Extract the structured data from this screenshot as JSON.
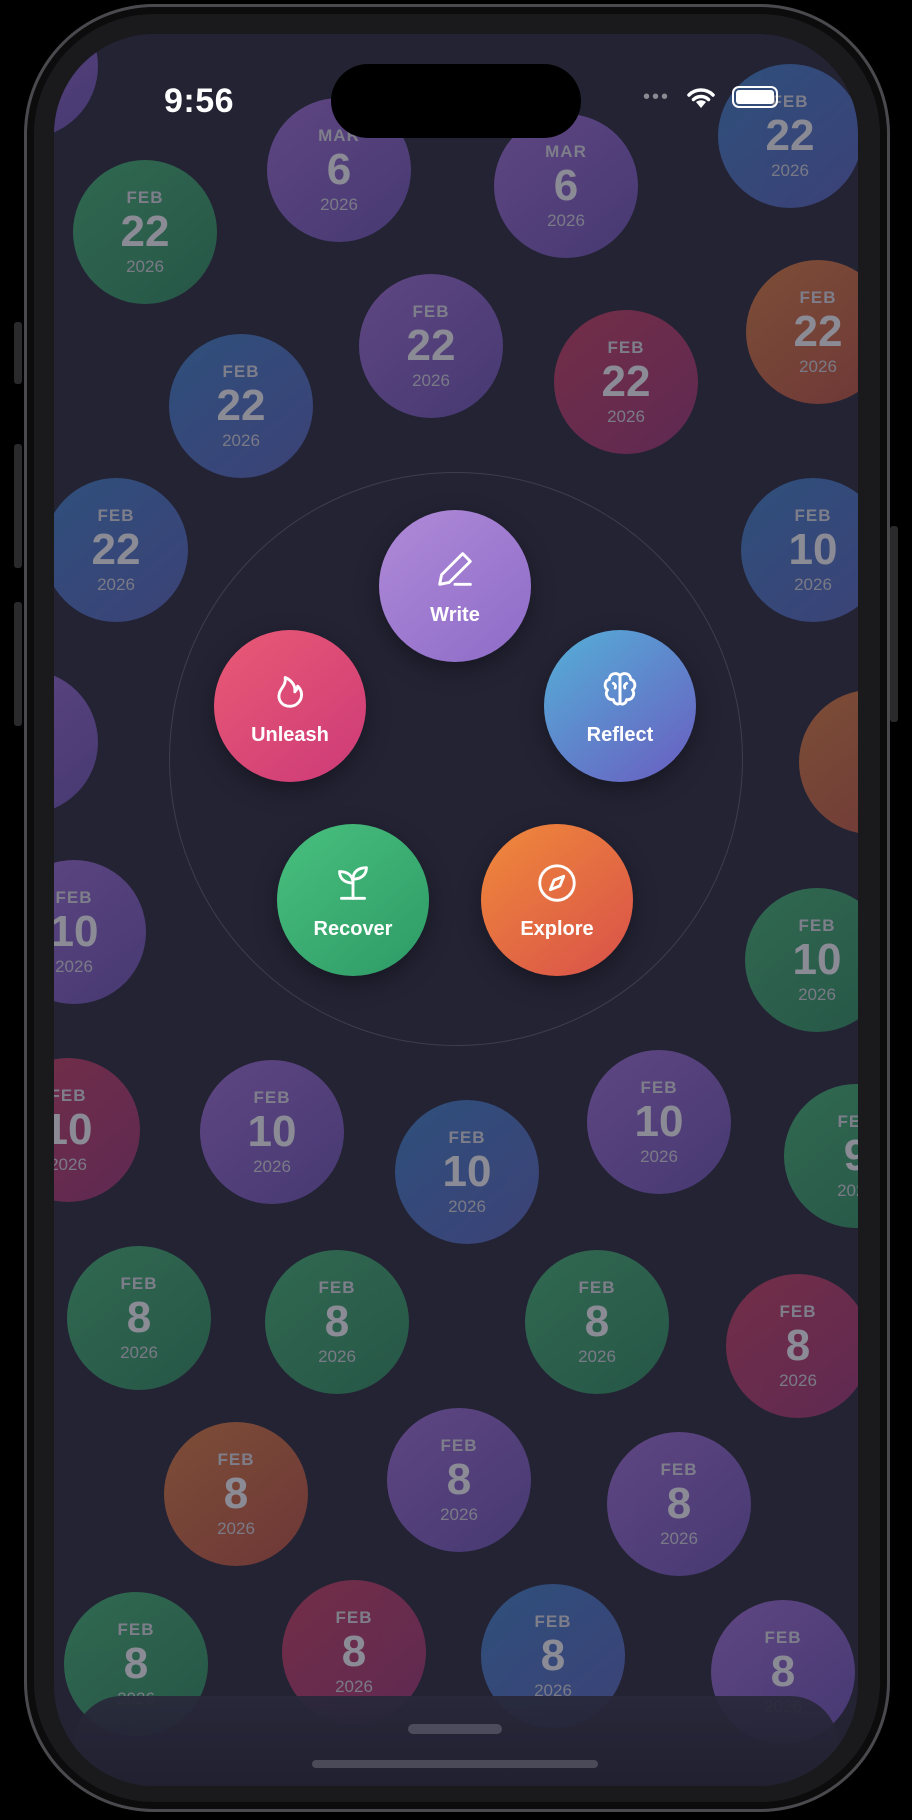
{
  "status_bar": {
    "time": "9:56"
  },
  "bubbles": [
    {
      "m": "MAR",
      "d": "6",
      "y": "2026"
    },
    {
      "m": "MAR",
      "d": "6",
      "y": "2026"
    },
    {
      "m": "FEB",
      "d": "22",
      "y": "2026"
    },
    {
      "m": "FEB",
      "d": "22",
      "y": "2026"
    },
    {
      "m": "FEB",
      "d": "22",
      "y": "2026"
    },
    {
      "m": "FEB",
      "d": "22",
      "y": "2026"
    },
    {
      "m": "FEB",
      "d": "22",
      "y": "2026"
    },
    {
      "m": "FEB",
      "d": "22",
      "y": "2026"
    },
    {
      "m": "FEB",
      "d": "22",
      "y": "2026"
    },
    {
      "m": "FEB",
      "d": "10",
      "y": "2026"
    },
    {
      "m": "FEB",
      "d": "10",
      "y": "2026"
    },
    {
      "m": "FEB",
      "d": "10",
      "y": "2026"
    },
    {
      "m": "FEB",
      "d": "10",
      "y": "2026"
    },
    {
      "m": "FEB",
      "d": "10",
      "y": "2026"
    },
    {
      "m": "FEB",
      "d": "10",
      "y": "2026"
    },
    {
      "m": "FEB",
      "d": "10",
      "y": "2026"
    },
    {
      "m": "FEB",
      "d": "9",
      "y": "2026"
    },
    {
      "m": "FEB",
      "d": "8",
      "y": "2026"
    },
    {
      "m": "FEB",
      "d": "8",
      "y": "2026"
    },
    {
      "m": "FEB",
      "d": "8",
      "y": "2026"
    },
    {
      "m": "FEB",
      "d": "8",
      "y": "2026"
    },
    {
      "m": "FEB",
      "d": "8",
      "y": "2026"
    },
    {
      "m": "FEB",
      "d": "8",
      "y": "2026"
    },
    {
      "m": "FEB",
      "d": "8",
      "y": "2026"
    },
    {
      "m": "FEB",
      "d": "8",
      "y": "2026"
    },
    {
      "m": "FEB",
      "d": "8",
      "y": "2026"
    },
    {
      "m": "FEB",
      "d": "8",
      "y": "2026"
    },
    {
      "m": "FEB",
      "d": "8",
      "y": "2026"
    }
  ],
  "actions": {
    "write": {
      "label": "Write",
      "icon": "pencil-icon"
    },
    "unleash": {
      "label": "Unleash",
      "icon": "flame-icon"
    },
    "reflect": {
      "label": "Reflect",
      "icon": "brain-icon"
    },
    "recover": {
      "label": "Recover",
      "icon": "sprout-icon"
    },
    "explore": {
      "label": "Explore",
      "icon": "compass-icon"
    }
  }
}
